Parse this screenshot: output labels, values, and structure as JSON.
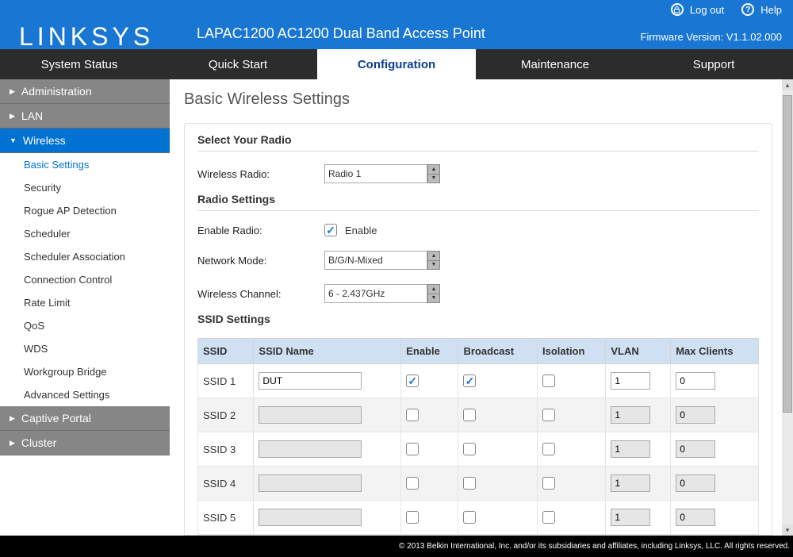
{
  "header": {
    "logo": "LINKSYS",
    "product": "LAPAC1200 AC1200 Dual Band Access Point",
    "logout": "Log out",
    "help": "Help",
    "firmware": "Firmware Version: V1.1.02.000"
  },
  "tabs": [
    "System Status",
    "Quick Start",
    "Configuration",
    "Maintenance",
    "Support"
  ],
  "activeTab": "Configuration",
  "sidebar": {
    "sections": [
      {
        "label": "Administration",
        "expanded": false
      },
      {
        "label": "LAN",
        "expanded": false
      },
      {
        "label": "Wireless",
        "expanded": true,
        "items": [
          "Basic Settings",
          "Security",
          "Rogue AP Detection",
          "Scheduler",
          "Scheduler Association",
          "Connection Control",
          "Rate Limit",
          "QoS",
          "WDS",
          "Workgroup Bridge",
          "Advanced Settings"
        ],
        "activeItem": "Basic Settings"
      },
      {
        "label": "Captive Portal",
        "expanded": false
      },
      {
        "label": "Cluster",
        "expanded": false
      }
    ]
  },
  "page": {
    "title": "Basic Wireless Settings",
    "selectRadio": {
      "heading": "Select Your Radio",
      "label": "Wireless Radio:",
      "value": "Radio 1"
    },
    "radioSettings": {
      "heading": "Radio Settings",
      "enableLabel": "Enable Radio:",
      "enableChecked": true,
      "enableText": "Enable",
      "modeLabel": "Network Mode:",
      "modeValue": "B/G/N-Mixed",
      "channelLabel": "Wireless Channel:",
      "channelValue": "6 - 2.437GHz"
    },
    "ssid": {
      "heading": "SSID Settings",
      "columns": [
        "SSID",
        "SSID Name",
        "Enable",
        "Broadcast",
        "Isolation",
        "VLAN",
        "Max Clients"
      ],
      "rows": [
        {
          "id": "SSID 1",
          "name": "DUT",
          "enable": true,
          "broadcast": true,
          "isolation": false,
          "vlan": "1",
          "max": "0",
          "disabled": false
        },
        {
          "id": "SSID 2",
          "name": "",
          "enable": false,
          "broadcast": false,
          "isolation": false,
          "vlan": "1",
          "max": "0",
          "disabled": true
        },
        {
          "id": "SSID 3",
          "name": "",
          "enable": false,
          "broadcast": false,
          "isolation": false,
          "vlan": "1",
          "max": "0",
          "disabled": true
        },
        {
          "id": "SSID 4",
          "name": "",
          "enable": false,
          "broadcast": false,
          "isolation": false,
          "vlan": "1",
          "max": "0",
          "disabled": true
        },
        {
          "id": "SSID 5",
          "name": "",
          "enable": false,
          "broadcast": false,
          "isolation": false,
          "vlan": "1",
          "max": "0",
          "disabled": true
        }
      ]
    }
  },
  "footer": "© 2013 Belkin International, Inc. and/or its subsidiaries and affiliates, including Linksys, LLC. All rights reserved."
}
